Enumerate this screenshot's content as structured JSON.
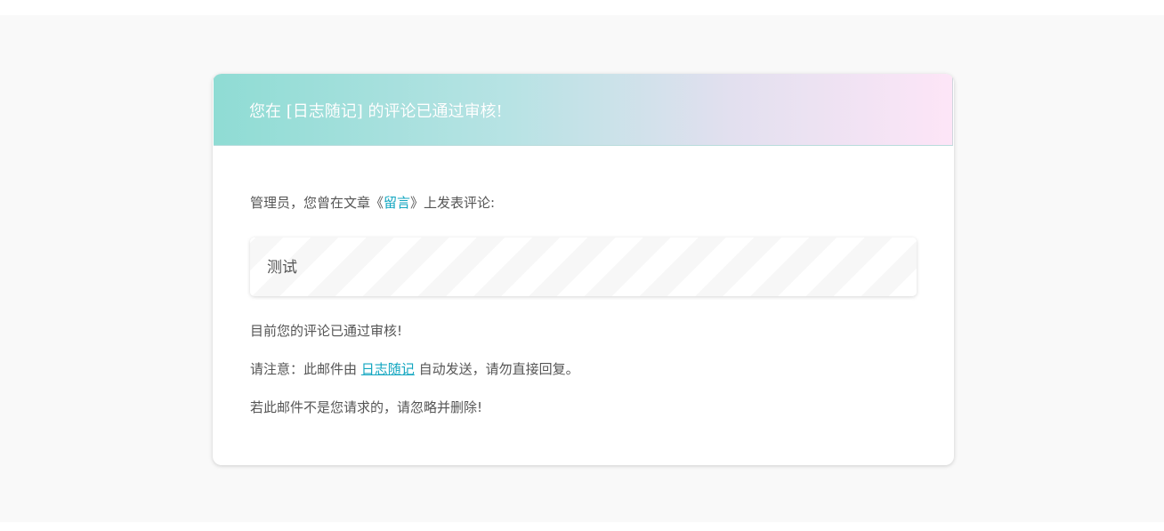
{
  "email": {
    "header_title": "您在 [日志随记] 的评论已通过审核!",
    "intro": {
      "before": "管理员，您曾在文章《",
      "article_title": "留言",
      "after": "》上发表评论:"
    },
    "comment_text": "测试",
    "status_text": "目前您的评论已通过审核!",
    "notice": {
      "before": "请注意：此邮件由 ",
      "site_name": "日志随记",
      "after": " 自动发送，请勿直接回复。"
    },
    "ignore_text": "若此邮件不是您请求的，请忽略并删除!"
  },
  "colors": {
    "link": "#12a6c0",
    "header_gradient_start": "#8fdcd4",
    "header_gradient_end": "#fde5f7",
    "text": "#555555"
  }
}
